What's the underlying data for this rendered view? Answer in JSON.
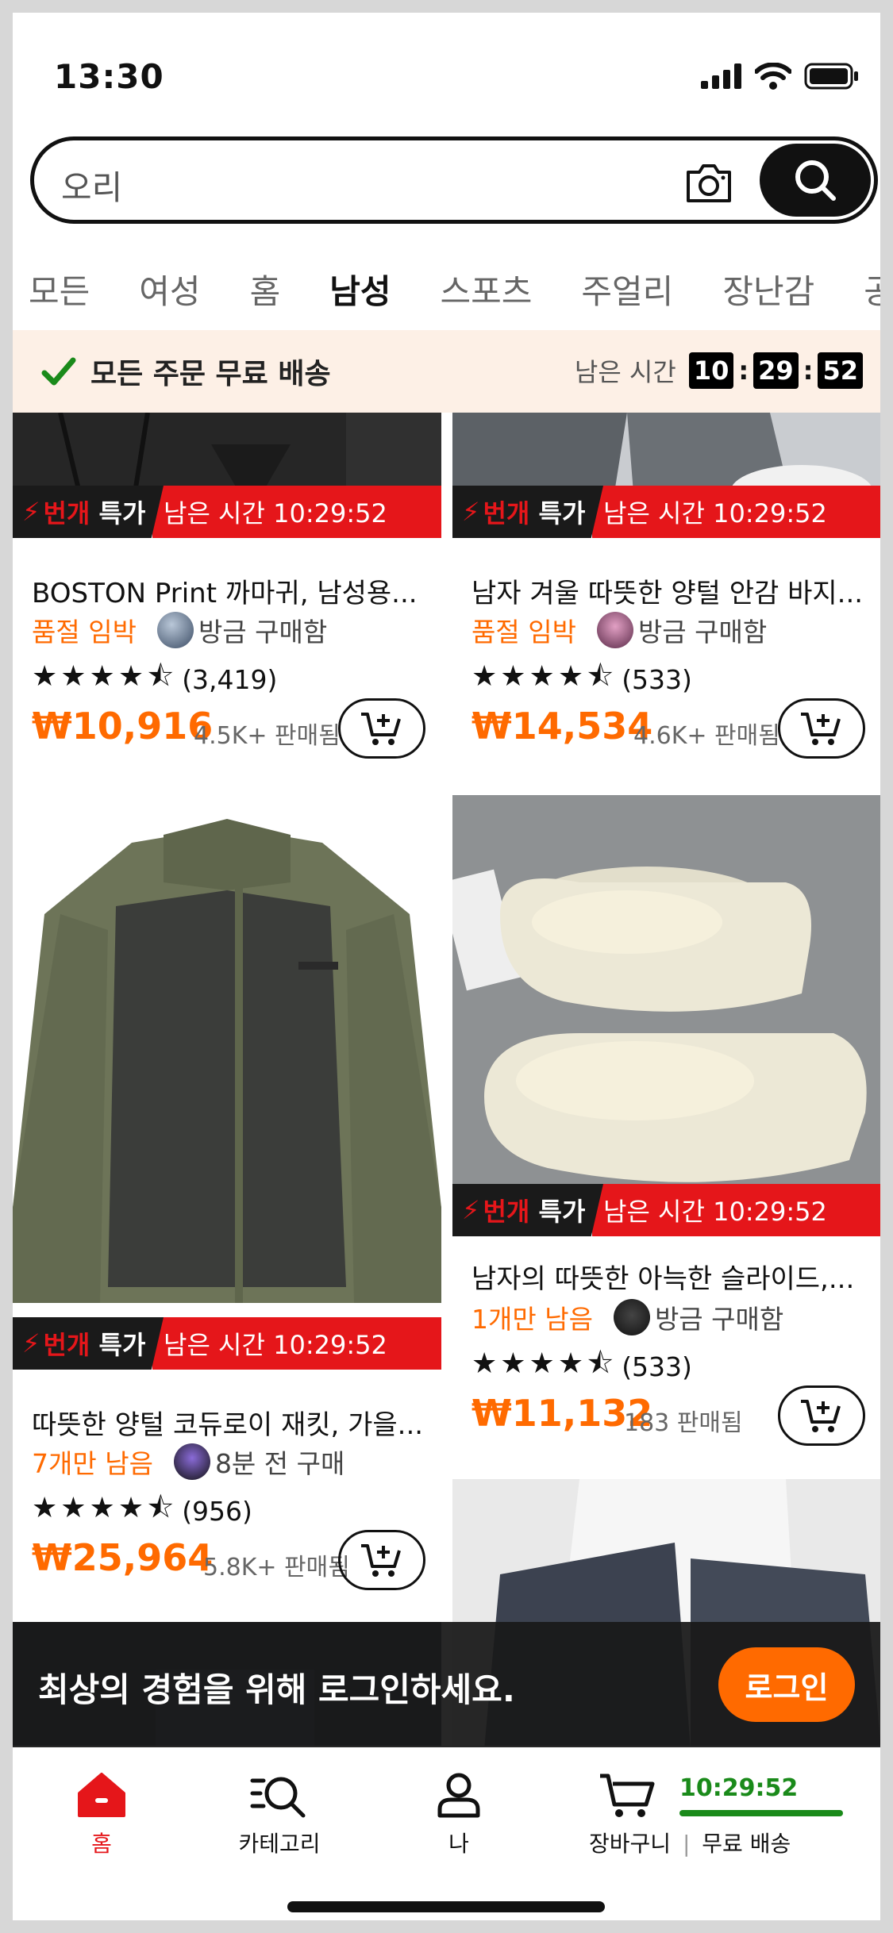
{
  "status_bar": {
    "time": "13:30"
  },
  "search": {
    "query": "오리"
  },
  "tabs": [
    {
      "label": "모든"
    },
    {
      "label": "여성"
    },
    {
      "label": "홈"
    },
    {
      "label": "남성"
    },
    {
      "label": "스포츠"
    },
    {
      "label": "주얼리"
    },
    {
      "label": "장난감"
    },
    {
      "label": "공예"
    }
  ],
  "banner": {
    "text": "모든 주문 무료 배송",
    "countdown_label": "남은 시간",
    "hh": "10",
    "mm": "29",
    "ss": "52"
  },
  "deal": {
    "tag_a": "번개",
    "tag_b": "특가",
    "time_text": "남은 시간 10:29:52"
  },
  "products": [
    {
      "title": "BOSTON Print 까마귀, 남성용...",
      "stock": "품절 임박",
      "activity": "방금 구매함",
      "stars": "★★★★⯪",
      "reviews": "(3,419)",
      "price": "₩10,916",
      "sold": "4.5K+ 판매됨"
    },
    {
      "title": "남자 겨울 따뜻한 양털 안감 바지...",
      "stock": "품절 임박",
      "activity": "방금 구매함",
      "stars": "★★★★⯪",
      "reviews": "(533)",
      "price": "₩14,534",
      "sold": "4.6K+ 판매됨"
    },
    {
      "title": "따뜻한 양털 코듀로이 재킷, 가을...",
      "stock": "7개만 남음",
      "activity": "8분 전 구매",
      "stars": "★★★★⯪",
      "reviews": "(956)",
      "price": "₩25,964",
      "sold": "5.8K+ 판매됨"
    },
    {
      "title": "남자의 따뜻한 아늑한 슬라이드,...",
      "stock": "1개만 남음",
      "activity": "방금 구매함",
      "stars": "★★★★⯪",
      "reviews": "(533)",
      "price": "₩11,132",
      "sold": "183 판매됨"
    }
  ],
  "login_prompt": {
    "text": "최상의 경험을 위해 로그인하세요.",
    "button": "로그인"
  },
  "nav": {
    "home": "홈",
    "category": "카테고리",
    "me": "나",
    "cart": "장바구니",
    "free_ship": "무료 배송",
    "free_ship_time": "10:29:52"
  },
  "colors": {
    "accent": "#ff6a00",
    "deal_red": "#e5161a",
    "ship_green": "#1a8a1a"
  }
}
